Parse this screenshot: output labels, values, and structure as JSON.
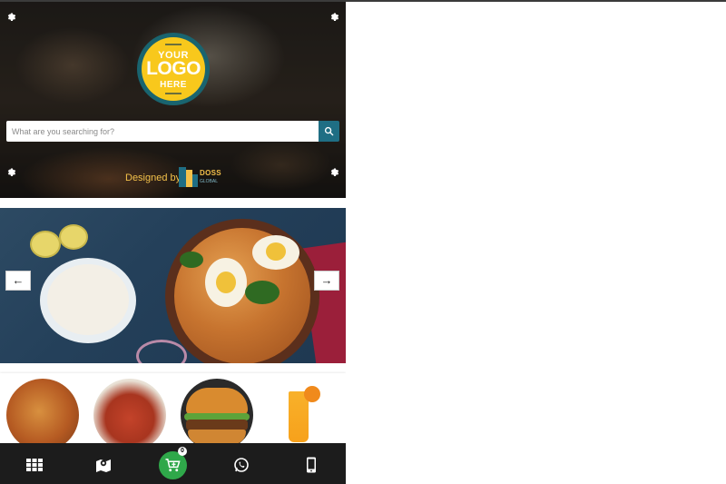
{
  "header": {
    "logo": {
      "line1": "YOUR",
      "line2": "LOGO",
      "line3": "HERE"
    },
    "search": {
      "placeholder": "What are you searching for?"
    },
    "credit": {
      "text": "Designed by",
      "brand": "DOSS",
      "brand_sub": "GLOBAL"
    },
    "icons": [
      "gear-icon",
      "gear-icon",
      "gear-icon",
      "gear-icon",
      "search-icon"
    ]
  },
  "banner": {
    "prev_label": "←",
    "next_label": "→"
  },
  "categories": [
    {
      "image": "biryani-chicken"
    },
    {
      "image": "biryani-plate"
    },
    {
      "image": "burger"
    },
    {
      "image": "orange-juice"
    }
  ],
  "bottom_nav": {
    "items": [
      {
        "icon": "grid-menu-icon"
      },
      {
        "icon": "map-icon"
      },
      {
        "icon": "cart-icon"
      },
      {
        "icon": "whatsapp-icon"
      },
      {
        "icon": "mobile-phone-icon"
      }
    ],
    "cart_count": "0"
  },
  "colors": {
    "accent": "#1f6e84",
    "logo_yellow": "#f8c81c",
    "cart_green": "#2fa84a",
    "bottom_bar": "#1c1c1c",
    "credit_text": "#f3c14a"
  }
}
